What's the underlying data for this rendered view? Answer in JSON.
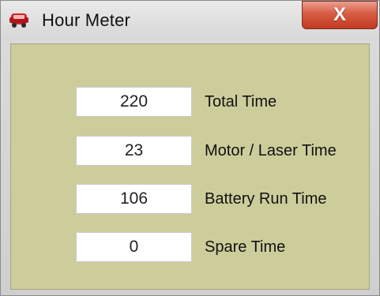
{
  "window": {
    "title": "Hour Meter",
    "close_label": "X",
    "colors": {
      "client_bg": "#cdcd9c",
      "close_red": "#c23b21"
    }
  },
  "meters": [
    {
      "value": "220",
      "label": "Total Time"
    },
    {
      "value": "23",
      "label": "Motor / Laser Time"
    },
    {
      "value": "106",
      "label": "Battery Run Time"
    },
    {
      "value": "0",
      "label": "Spare Time"
    }
  ]
}
